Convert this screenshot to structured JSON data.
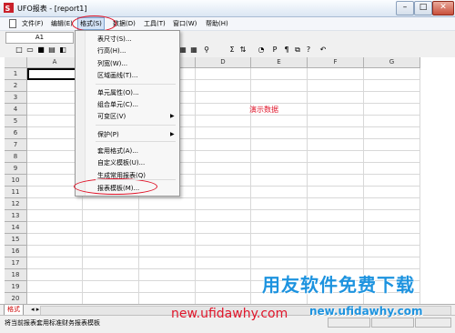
{
  "window": {
    "title": "UFO报表 - [report1]",
    "minimize": "–",
    "maximize": "□",
    "close": "✕"
  },
  "menu": [
    "文件(F)",
    "编辑(E)",
    "格式(S)",
    "数据(D)",
    "工具(T)",
    "窗口(W)",
    "帮助(H)"
  ],
  "active_menu_index": 2,
  "namebox": {
    "value": "A1"
  },
  "columns": [
    "A",
    "B",
    "C",
    "D",
    "E",
    "F",
    "G"
  ],
  "rows": [
    "1",
    "2",
    "3",
    "4",
    "5",
    "6",
    "7",
    "8",
    "9",
    "10",
    "11",
    "12",
    "13",
    "14",
    "15",
    "16",
    "17",
    "18",
    "19",
    "20"
  ],
  "toolbar_icons": [
    {
      "name": "new-icon",
      "glyph": "□"
    },
    {
      "name": "open-icon",
      "glyph": "▭"
    },
    {
      "name": "save-icon",
      "glyph": "■"
    },
    {
      "name": "print-icon",
      "glyph": "▤"
    },
    {
      "name": "preview-icon",
      "glyph": "◧"
    },
    {
      "name": "grid-icon-1",
      "glyph": "▦"
    },
    {
      "name": "grid-icon-2",
      "glyph": "▦"
    },
    {
      "name": "find-icon",
      "glyph": "⚲"
    },
    {
      "name": "sum-icon",
      "glyph": "Σ"
    },
    {
      "name": "sort-icon",
      "glyph": "⇅"
    },
    {
      "name": "chart-icon",
      "glyph": "◔"
    },
    {
      "name": "p-icon",
      "glyph": "P"
    },
    {
      "name": "format-icon",
      "glyph": "¶"
    },
    {
      "name": "link-icon",
      "glyph": "⧉"
    },
    {
      "name": "help-icon",
      "glyph": "?"
    },
    {
      "name": "undo-icon",
      "glyph": "↶"
    }
  ],
  "format_menu_items": [
    {
      "label": "表尺寸(S)..."
    },
    {
      "label": "行高(H)..."
    },
    {
      "label": "列宽(W)..."
    },
    {
      "label": "区域画线(T)..."
    },
    {
      "label": "单元属性(O)..."
    },
    {
      "label": "组合单元(C)..."
    },
    {
      "label": "可变区(V)",
      "submenu": true
    },
    {
      "label": "保护(P)",
      "submenu": true
    },
    {
      "label": "套用格式(A)..."
    },
    {
      "label": "自定义模板(U)..."
    },
    {
      "label": "生成常用报表(Q)"
    },
    {
      "label": "报表模板(M)...",
      "highlighted": true
    }
  ],
  "submenu_arrow": "▶",
  "sheet": {
    "tab": "格式",
    "nav": "◂ ▸"
  },
  "cell_text": "演示数据",
  "status": {
    "text": "将当前报表套用标准财务报表模板"
  },
  "watermark": {
    "brand": "用友软件免费下载",
    "url_main": "new.ufidawhy.com",
    "url_overlay": "new.ufidawhy.com"
  },
  "colors": {
    "accent_red": "#e0152a",
    "watermark_blue": "#1d93df"
  }
}
